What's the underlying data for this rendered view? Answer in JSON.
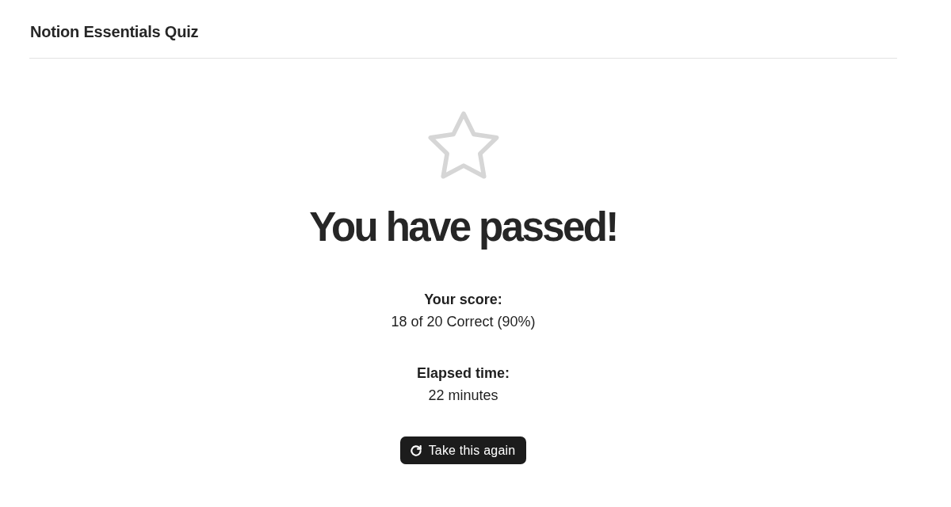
{
  "header": {
    "title": "Notion Essentials Quiz"
  },
  "result": {
    "heading": "You have passed!"
  },
  "stats": [
    {
      "label": "Your score:",
      "value": "18 of 20 Correct (90%)"
    },
    {
      "label": "Elapsed time:",
      "value": "22 minutes"
    }
  ],
  "actions": [
    {
      "label": "Take this again"
    }
  ]
}
